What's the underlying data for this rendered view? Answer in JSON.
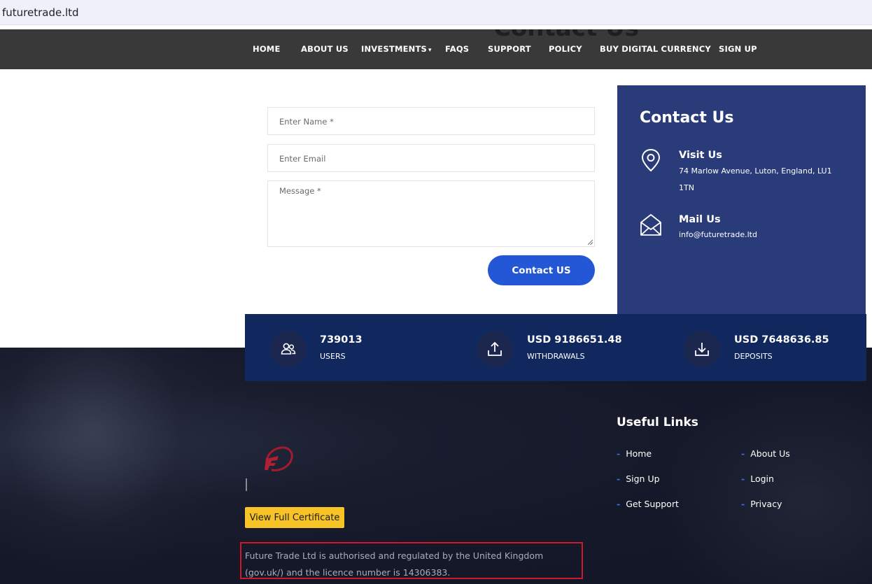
{
  "browser": {
    "url": "futuretrade.ltd"
  },
  "nav": {
    "ghost_heading": "Contact Us",
    "items": [
      {
        "label": "HOME"
      },
      {
        "label": "ABOUT US"
      },
      {
        "label": "INVESTMENTS",
        "has_dropdown": true
      },
      {
        "label": "FAQS"
      },
      {
        "label": "SUPPORT"
      },
      {
        "label": "POLICY"
      },
      {
        "label": "BUY DIGITAL CURRENCY"
      },
      {
        "label": "SIGN UP"
      }
    ],
    "dropdown_icon": "chevron-down-icon"
  },
  "form": {
    "name_placeholder": "Enter Name *",
    "email_placeholder": "Enter Email",
    "message_placeholder": "Message *",
    "submit_label": "Contact US"
  },
  "contact": {
    "title": "Contact Us",
    "visit_title": "Visit Us",
    "visit_address": "74 Marlow Avenue, Luton, England, LU1 1TN",
    "visit_icon": "map-pin-icon",
    "mail_title": "Mail Us",
    "mail_address": "info@futuretrade.ltd",
    "mail_icon": "envelope-icon"
  },
  "stats": {
    "users": {
      "value": "739013",
      "label": "USERS",
      "icon": "users-icon"
    },
    "withdrawals": {
      "value": "USD 9186651.48",
      "label": "WITHDRAWALS",
      "icon": "upload-icon"
    },
    "deposits": {
      "value": "USD 7648636.85",
      "label": "DEPOSITS",
      "icon": "download-icon"
    }
  },
  "footer": {
    "certificate_button": "View Full Certificate",
    "regulation_text": "Future Trade Ltd is authorised and regulated by the United Kingdom (gov.uk/) and the licence number is 14306383.",
    "useful_links_title": "Useful Links",
    "links": {
      "home": "Home",
      "about": "About Us",
      "signup": "Sign Up",
      "login": "Login",
      "support": "Get Support",
      "privacy": "Privacy"
    }
  },
  "colors": {
    "nav_bg": "#3a3939",
    "accent_blue": "#2457d6",
    "contact_panel": "#2a3b79",
    "stats_bar": "#11285f",
    "certificate_yellow": "#f8c326",
    "highlight_red": "#d0182b"
  }
}
